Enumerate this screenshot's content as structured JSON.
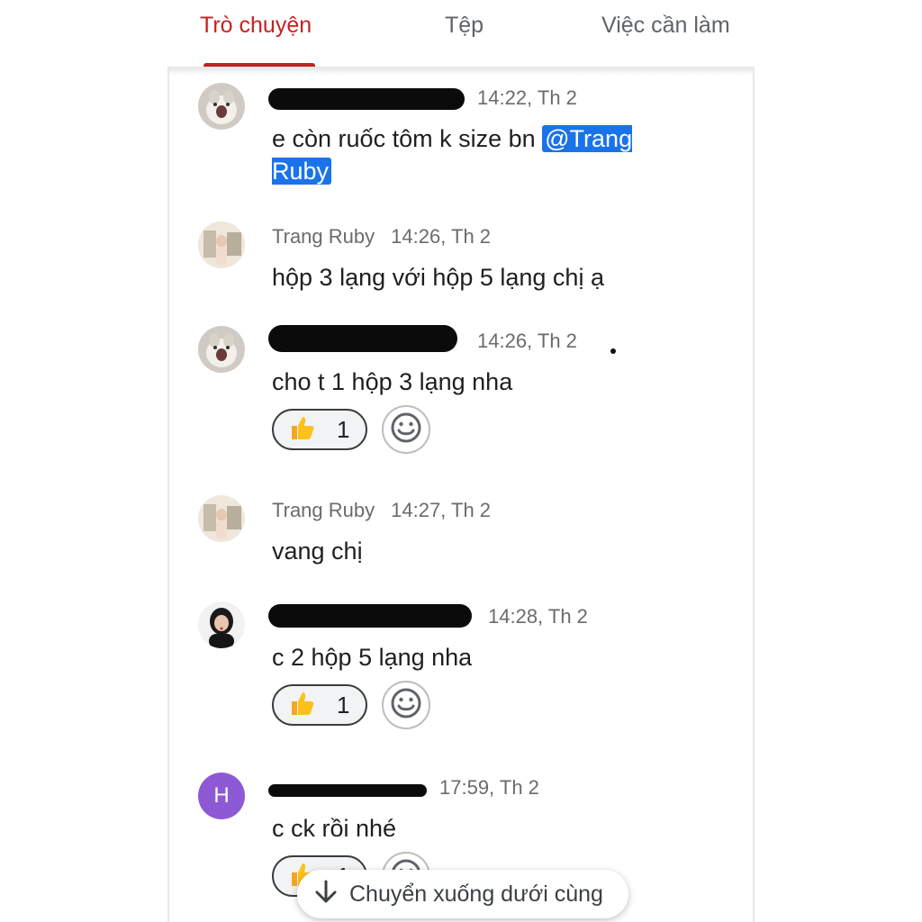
{
  "tabs": [
    {
      "label": "Trò chuyện",
      "active": true
    },
    {
      "label": "Tệp",
      "active": false
    },
    {
      "label": "Việc cần làm",
      "active": false
    }
  ],
  "colors": {
    "accent": "#c5221f",
    "mention": "#1a73e8",
    "avatar_letter_bg": "#8e59d4"
  },
  "messages": [
    {
      "sender": "",
      "sender_redacted": true,
      "time": "14:22, Th 2",
      "text_before": "e còn ruốc tôm k size bn ",
      "mention": "@Trang Ruby"
    },
    {
      "sender": "Trang Ruby",
      "time": "14:26, Th 2",
      "text": "hộp 3 lạng với hộp 5 lạng chị ạ"
    },
    {
      "sender": "",
      "sender_redacted": true,
      "time": "14:26, Th 2",
      "text": "cho t 1 hộp 3 lạng nha",
      "reaction": {
        "emoji": "thumbs-up",
        "count": "1"
      }
    },
    {
      "sender": "Trang Ruby",
      "time": "14:27, Th 2",
      "text": "vang chị"
    },
    {
      "sender": "",
      "sender_redacted": true,
      "time": "14:28, Th 2",
      "text": "c 2 hộp 5 lạng nha",
      "reaction": {
        "emoji": "thumbs-up",
        "count": "1"
      }
    },
    {
      "sender": "",
      "sender_redacted": true,
      "avatar_letter": "H",
      "time": "17:59, Th 2",
      "text": "c ck rồi nhé",
      "reaction": {
        "emoji": "thumbs-up",
        "count": "1"
      }
    }
  ],
  "jump_to_bottom": {
    "label": "Chuyển xuống dưới cùng",
    "icon": "arrow-down-icon"
  }
}
